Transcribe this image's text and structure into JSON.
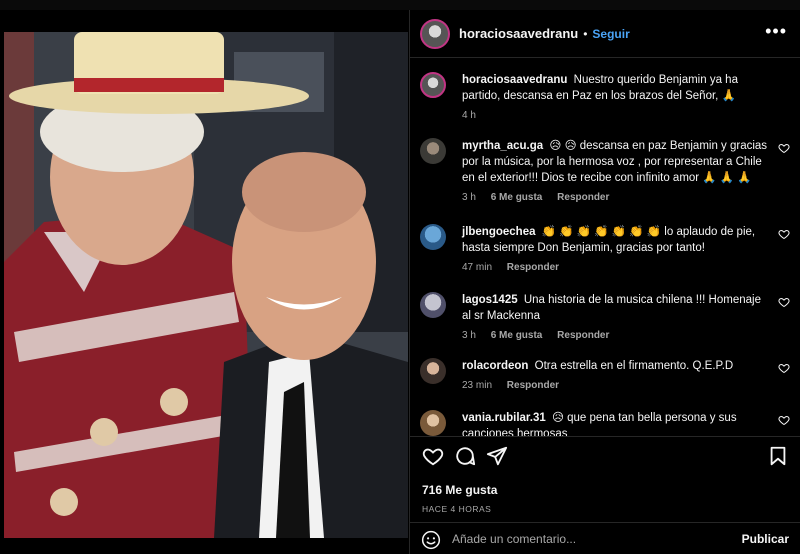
{
  "post": {
    "author": "horaciosaavedranu",
    "separator": "•",
    "follow_label": "Seguir",
    "more_label": "•••",
    "caption_user": "horaciosaavedranu",
    "caption_text": "Nuestro querido Benjamin ya ha partido, descansa en Paz en los brazos del Señor, 🙏",
    "caption_time": "4 h"
  },
  "comments": [
    {
      "user": "myrtha_acu.ga",
      "text": "😥 😥 descansa en paz Benjamin y gracias por la música, por la hermosa voz , por representar a Chile en el exterior!!! Dios te recibe con infinito amor 🙏 🙏 🙏",
      "time": "3 h",
      "likes": "6 Me gusta",
      "reply": "Responder"
    },
    {
      "user": "jlbengoechea",
      "text": "👏 👏 👏 👏 👏 👏 👏 lo aplaudo de pie, hasta siempre Don Benjamin, gracias por tanto!",
      "time": "47 min",
      "likes": "",
      "reply": "Responder"
    },
    {
      "user": "lagos1425",
      "text": "Una historia de la musica chilena !!! Homenaje al sr Mackenna",
      "time": "3 h",
      "likes": "6 Me gusta",
      "reply": "Responder"
    },
    {
      "user": "rolacordeon",
      "text": "Otra estrella en el firmamento. Q.E.P.D",
      "time": "23 min",
      "likes": "",
      "reply": "Responder"
    },
    {
      "user": "vania.rubilar.31",
      "text": "😥 que pena tan bella persona y sus canciones hermosas",
      "time": "",
      "likes": "",
      "reply": ""
    }
  ],
  "actions": {
    "likes_count": "716 Me gusta",
    "posted_ago": "HACE 4 HORAS"
  },
  "comment_box": {
    "placeholder": "Añade un comentario...",
    "publish_label": "Publicar"
  },
  "icons": {
    "like": "heart-icon",
    "comment": "comment-icon",
    "share": "share-icon",
    "save": "bookmark-icon",
    "emoji": "emoji-icon",
    "more": "more-options-icon"
  },
  "colors": {
    "background": "#000000",
    "follow_blue": "#4aa3f5",
    "text": "#f5f5f5",
    "muted": "#a8a8a8",
    "divider": "#262626"
  }
}
